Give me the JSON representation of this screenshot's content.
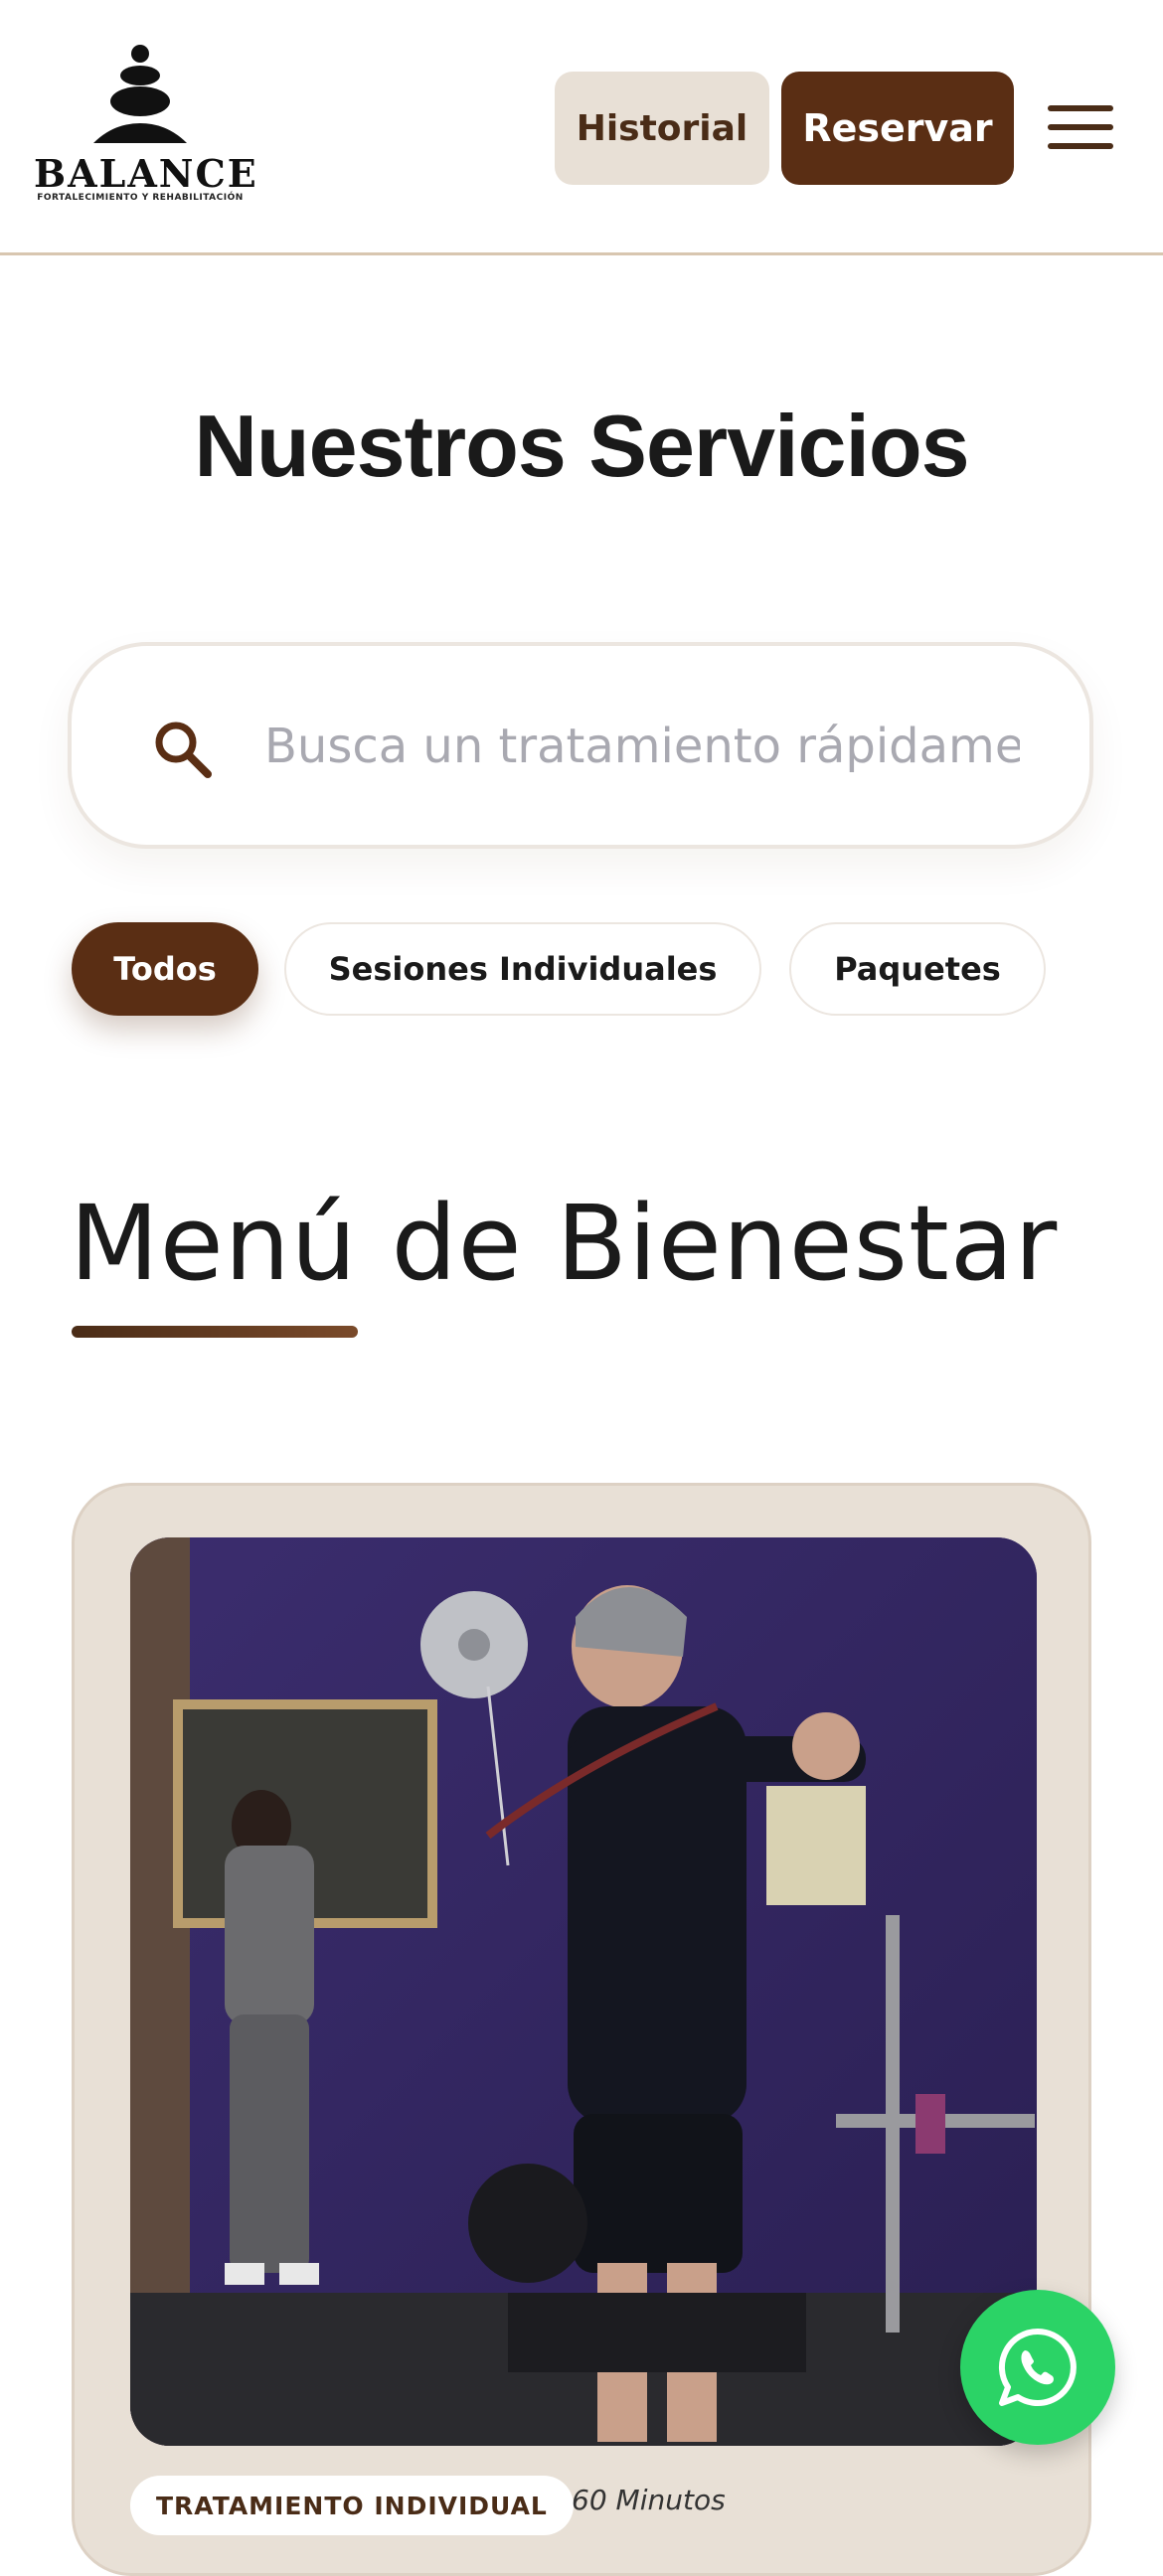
{
  "header": {
    "logo_name": "BALANCE",
    "logo_tagline": "FORTALECIMIENTO Y REHABILITACIÓN",
    "historial_label": "Historial",
    "reservar_label": "Reservar",
    "menu_icon": "hamburger-icon"
  },
  "main": {
    "title": "Nuestros Servicios",
    "search": {
      "placeholder": "Busca un tratamiento rápidamente...",
      "value": "",
      "icon": "search-icon"
    },
    "filters": [
      {
        "label": "Todos",
        "active": true
      },
      {
        "label": "Sesiones Individuales",
        "active": false
      },
      {
        "label": "Paquetes",
        "active": false
      }
    ],
    "section_title": "Menú de Bienestar",
    "cards": [
      {
        "badge": "TRATAMIENTO INDIVIDUAL",
        "duration": "60 Minutos"
      }
    ]
  },
  "floating": {
    "whatsapp_icon": "whatsapp-icon"
  },
  "colors": {
    "brand_brown": "#5a2e14",
    "chip_light": "#e8e0d6",
    "card_bg": "#e8e0d6",
    "whatsapp_green": "#2bd366"
  }
}
